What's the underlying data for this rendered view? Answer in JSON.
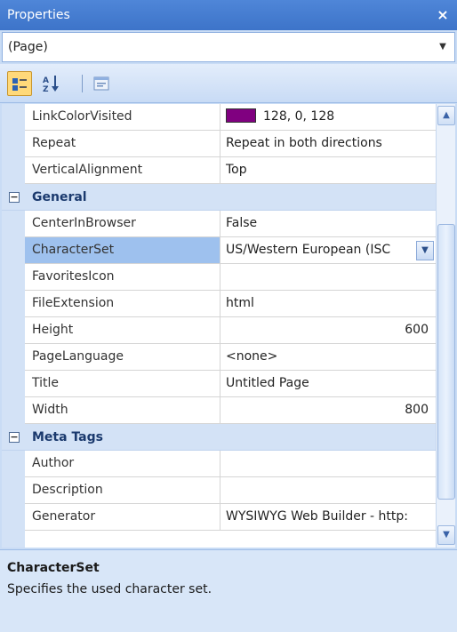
{
  "window": {
    "title": "Properties",
    "close_glyph": "×"
  },
  "object_selector": {
    "value": "(Page)"
  },
  "toolbar": {
    "buttons": [
      {
        "icon": "categorized-icon",
        "active": true
      },
      {
        "icon": "alphabetical-sort-icon",
        "glyph": "A↓"
      },
      {
        "icon": "property-pages-icon"
      }
    ]
  },
  "grid": {
    "rows": [
      {
        "name": "LinkColorVisited",
        "value": "128, 0, 128",
        "swatch": "#800080"
      },
      {
        "name": "Repeat",
        "value": "Repeat in both directions"
      },
      {
        "name": "VerticalAlignment",
        "value": "Top"
      },
      {
        "category": "General",
        "expander": "⊟"
      },
      {
        "name": "CenterInBrowser",
        "value": "False"
      },
      {
        "name": "CharacterSet",
        "value": "US/Western European (ISC",
        "selected": true
      },
      {
        "name": "FavoritesIcon",
        "value": ""
      },
      {
        "name": "FileExtension",
        "value": "html"
      },
      {
        "name": "Height",
        "value": "600"
      },
      {
        "name": "PageLanguage",
        "value": "<none>"
      },
      {
        "name": "Title",
        "value": "Untitled Page"
      },
      {
        "name": "Width",
        "value": "800"
      },
      {
        "category": "Meta Tags",
        "expander": "⊟"
      },
      {
        "name": "Author",
        "value": ""
      },
      {
        "name": "Description",
        "value": ""
      },
      {
        "name": "Generator",
        "value": "WYSIWYG Web Builder - http:"
      }
    ]
  },
  "help": {
    "title": "CharacterSet",
    "description": "Specifies the used character set."
  },
  "colors": {
    "titlebar": "#3d74c9",
    "selection": "#9ec1ee",
    "category_bg": "#d3e2f6"
  }
}
